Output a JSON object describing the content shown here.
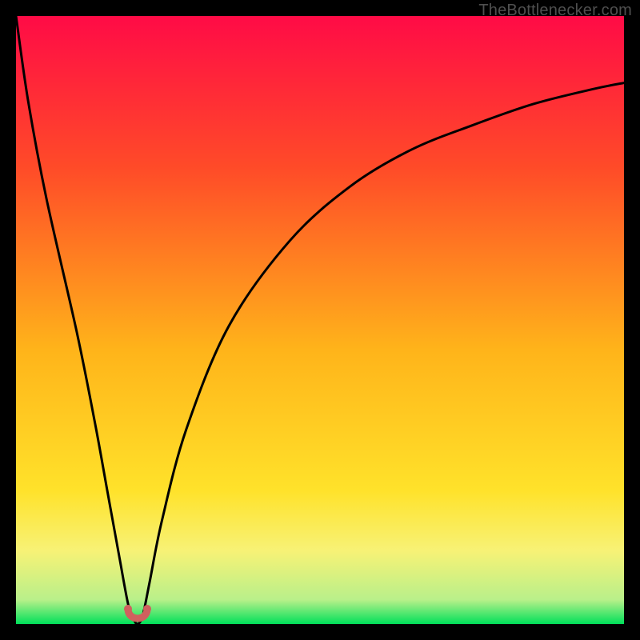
{
  "watermark": {
    "text": "TheBottlenecker.com"
  },
  "chart_data": {
    "type": "line",
    "title": "",
    "xlabel": "",
    "ylabel": "",
    "x": [
      0,
      2,
      5,
      10,
      13,
      15,
      17,
      18.5,
      19.5,
      20,
      20.5,
      21,
      22,
      24,
      28,
      35,
      45,
      55,
      65,
      75,
      85,
      95,
      100
    ],
    "values": [
      100,
      86,
      70,
      48,
      33,
      22,
      11,
      3,
      0.5,
      0,
      0.5,
      2,
      7,
      17,
      32,
      49,
      63,
      72,
      78,
      82,
      85.5,
      88,
      89
    ],
    "xlim": [
      0,
      100
    ],
    "ylim": [
      0,
      100
    ],
    "minimum_at_x": 20,
    "annotations": [
      {
        "kind": "dip-marker",
        "shape": "U",
        "x": 20,
        "y": 0,
        "color": "#d0605e"
      }
    ],
    "background_gradient": {
      "direction": "vertical",
      "stops": [
        {
          "pos": 0,
          "color": "#ff0b46"
        },
        {
          "pos": 25,
          "color": "#ff4b28"
        },
        {
          "pos": 55,
          "color": "#ffb41a"
        },
        {
          "pos": 78,
          "color": "#ffe22a"
        },
        {
          "pos": 88,
          "color": "#f7f276"
        },
        {
          "pos": 96,
          "color": "#b9f08a"
        },
        {
          "pos": 100,
          "color": "#00e05a"
        }
      ]
    },
    "curve_stroke": "#000000",
    "curve_width": 3
  }
}
